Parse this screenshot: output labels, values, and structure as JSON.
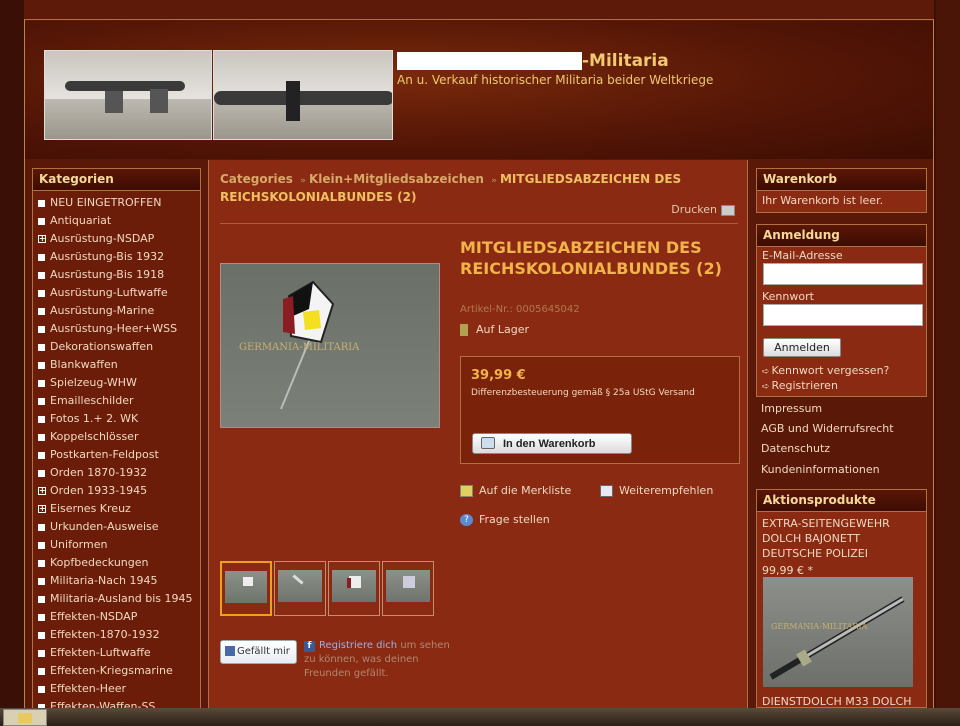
{
  "header": {
    "site_title": "-Militaria",
    "site_subtitle": "An u. Verkauf historischer Militaria beider Weltkriege"
  },
  "categories": {
    "title": "Kategorien",
    "items": [
      {
        "label": "NEU EINGETROFFEN",
        "expandable": false
      },
      {
        "label": "Antiquariat",
        "expandable": false
      },
      {
        "label": "Ausrüstung-NSDAP",
        "expandable": true
      },
      {
        "label": "Ausrüstung-Bis 1932",
        "expandable": false
      },
      {
        "label": "Ausrüstung-Bis 1918",
        "expandable": false
      },
      {
        "label": "Ausrüstung-Luftwaffe",
        "expandable": false
      },
      {
        "label": "Ausrüstung-Marine",
        "expandable": false
      },
      {
        "label": "Ausrüstung-Heer+WSS",
        "expandable": false
      },
      {
        "label": "Dekorationswaffen",
        "expandable": false
      },
      {
        "label": "Blankwaffen",
        "expandable": false
      },
      {
        "label": "Spielzeug-WHW",
        "expandable": false
      },
      {
        "label": "Emailleschilder",
        "expandable": false
      },
      {
        "label": "Fotos 1.+ 2. WK",
        "expandable": false
      },
      {
        "label": "Koppelschlösser",
        "expandable": false
      },
      {
        "label": "Postkarten-Feldpost",
        "expandable": false
      },
      {
        "label": "Orden 1870-1932",
        "expandable": false
      },
      {
        "label": "Orden 1933-1945",
        "expandable": true
      },
      {
        "label": "Eisernes Kreuz",
        "expandable": true
      },
      {
        "label": "Urkunden-Ausweise",
        "expandable": false
      },
      {
        "label": "Uniformen",
        "expandable": false
      },
      {
        "label": "Kopfbedeckungen",
        "expandable": false
      },
      {
        "label": "Militaria-Nach 1945",
        "expandable": false
      },
      {
        "label": "Militaria-Ausland bis 1945",
        "expandable": false
      },
      {
        "label": "Effekten-NSDAP",
        "expandable": false
      },
      {
        "label": "Effekten-1870-1932",
        "expandable": false
      },
      {
        "label": "Effekten-Luftwaffe",
        "expandable": false
      },
      {
        "label": "Effekten-Kriegsmarine",
        "expandable": false
      },
      {
        "label": "Effekten-Heer",
        "expandable": false
      },
      {
        "label": "Effekten-Waffen-SS",
        "expandable": false
      }
    ]
  },
  "breadcrumb": {
    "root": "Categories",
    "parent": "Klein+Mitgliedsabzeichen",
    "current": "MITGLIEDSABZEICHEN DES REICHSKOLONIALBUNDES (2)"
  },
  "product": {
    "print_label": "Drucken",
    "title": "MITGLIEDSABZEICHEN DES REICHSKOLONIALBUNDES (2)",
    "article_nr": "Artikel-Nr.: 0005645042",
    "stock": "Auf Lager",
    "price": "39,99 €",
    "tax_note": "Differenzbesteuerung gemäß § 25a UStG Versand",
    "cart_button": "In den Warenkorb",
    "wishlist": "Auf die Merkliste",
    "recommend": "Weiterempfehlen",
    "ask": "Frage stellen",
    "watermark": "GERMANIA-MILITARIA"
  },
  "social": {
    "like_button": "Gefällt mir",
    "register_link": "Registriere dich",
    "register_text": "um sehen zu können, was deinen Freunden gefällt."
  },
  "cart": {
    "title": "Warenkorb",
    "empty_text": "Ihr Warenkorb ist leer."
  },
  "login": {
    "title": "Anmeldung",
    "email_label": "E-Mail-Adresse",
    "password_label": "Kennwort",
    "button": "Anmelden",
    "forgot": "Kennwort vergessen?",
    "register": "Registrieren"
  },
  "pages": [
    "Impressum",
    "AGB und Widerrufsrecht",
    "Datenschutz",
    "Kundeninformationen"
  ],
  "specials": {
    "title": "Aktionsprodukte",
    "item1_name": "EXTRA-SEITENGEWEHR DOLCH BAJONETT DEUTSCHE POLIZEI",
    "item1_price": "99,99 € *",
    "item1_watermark": "GERMANIA-MILITARIA",
    "item2_name": "DIENSTDOLCH M33 DOLCH"
  }
}
